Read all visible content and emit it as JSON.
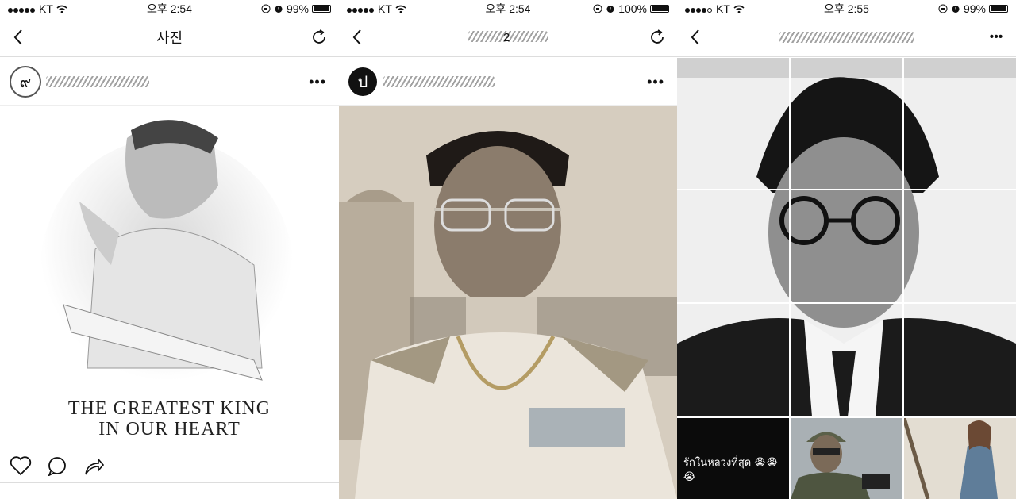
{
  "screens": [
    {
      "status": {
        "carrier": "KT",
        "time": "오후 2:54",
        "battery": "99%",
        "battery_level": 0.99
      },
      "nav": {
        "title": "사진"
      },
      "post": {
        "avatar_glyph": "๙",
        "headline_1": "THE GREATEST KING",
        "headline_2": "IN OUR HEART"
      }
    },
    {
      "status": {
        "carrier": "KT",
        "time": "오후 2:54",
        "battery": "100%",
        "battery_level": 1.0
      },
      "nav": {
        "title": "2"
      },
      "post": {
        "avatar_glyph": "ป"
      }
    },
    {
      "status": {
        "carrier": "KT",
        "time": "오후 2:55",
        "battery": "99%",
        "battery_level": 0.99
      },
      "grid": {
        "caption": "รักในหลวงที่สุด 😭😭😭"
      }
    }
  ],
  "icons": {
    "back": "chevron-left-icon",
    "refresh": "refresh-icon",
    "more": "more-icon",
    "like": "heart-icon",
    "comment": "comment-icon",
    "share": "share-icon",
    "wifi": "wifi-icon",
    "alarm": "alarm-icon",
    "lock": "rotation-lock-icon"
  }
}
